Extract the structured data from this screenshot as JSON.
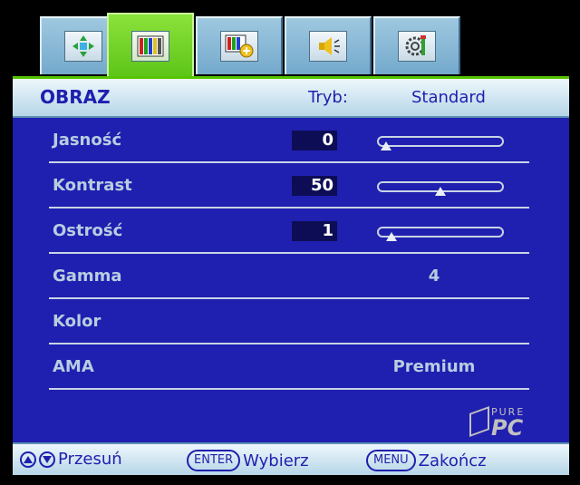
{
  "tabs": [
    {
      "icon": "move-position-icon",
      "active": false
    },
    {
      "icon": "picture-icon",
      "active": true
    },
    {
      "icon": "picture-add-icon",
      "active": false
    },
    {
      "icon": "speaker-icon",
      "active": false
    },
    {
      "icon": "settings-gear-icon",
      "active": false
    }
  ],
  "header": {
    "title": "OBRAZ",
    "mode_label": "Tryb:",
    "mode_value": "Standard"
  },
  "settings": [
    {
      "label": "Jasność",
      "value": "0",
      "level": 0
    },
    {
      "label": "Kontrast",
      "value": "50",
      "level": 0.5
    },
    {
      "label": "Ostrość",
      "value": "1",
      "level": 0.05
    },
    {
      "label": "Gamma",
      "value": "4"
    },
    {
      "label": "Kolor",
      "value": ""
    },
    {
      "label": "AMA",
      "value": "Premium"
    }
  ],
  "footer": {
    "move_label": "Przesuń",
    "enter_key": "ENTER",
    "enter_label": "Wybierz",
    "menu_key": "MENU",
    "menu_label": "Zakończ"
  },
  "watermark": {
    "brand_top": "PURE",
    "brand_main": "PC"
  },
  "colors": {
    "panel": "#1f1fb0",
    "accent_active_tab": "#5dc418",
    "title_text": "#1f1fae"
  }
}
